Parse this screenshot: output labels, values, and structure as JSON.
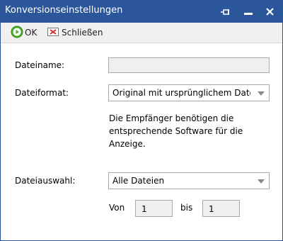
{
  "window": {
    "title": "Konversionseinstellungen"
  },
  "titlebar_icons": {
    "pin": "pin-icon",
    "minimize": "minimize-icon",
    "close": "close-icon"
  },
  "toolbar": {
    "ok_label": "OK",
    "ok_icon": "play-icon",
    "close_label": "Schließen",
    "close_icon": "close-document-icon"
  },
  "form": {
    "filename_label": "Dateiname:",
    "filename_value": "",
    "format_label": "Dateiformat:",
    "format_value": "Original mit ursprünglichem Dateinam",
    "note": "Die Empfänger benötigen die entsprechende Software für die Anzeige.",
    "selection_label": "Dateiauswahl:",
    "selection_value": "Alle Dateien",
    "from_label": "Von",
    "from_value": "1",
    "to_label": "bis",
    "to_value": "1"
  },
  "colors": {
    "titlebar": "#2b579a",
    "ok_green": "#4cae27",
    "close_red": "#d9302b"
  }
}
